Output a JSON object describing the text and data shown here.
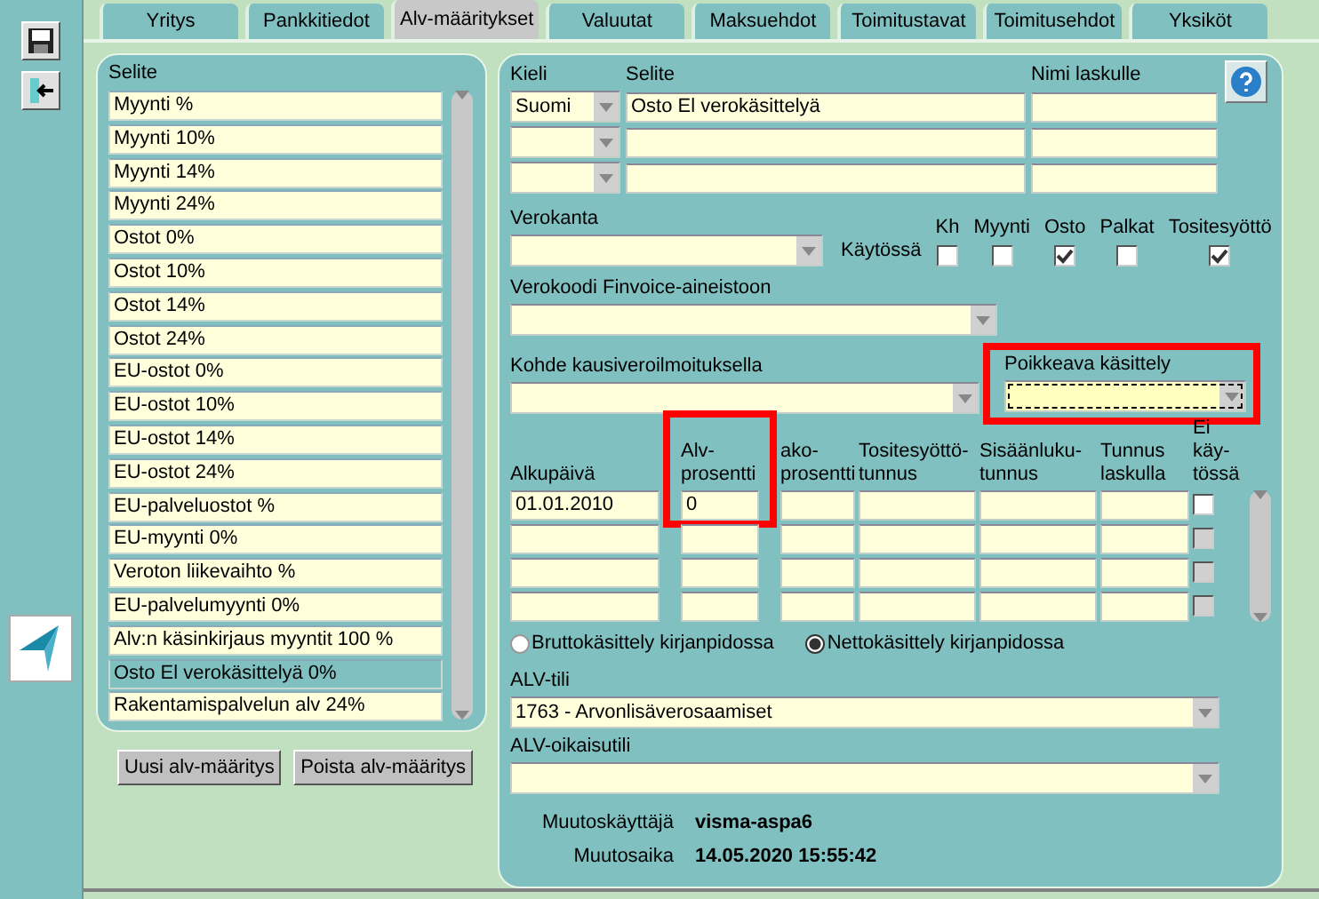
{
  "tabs": [
    {
      "label": "Yritys",
      "selected": false
    },
    {
      "label": "Pankkitiedot",
      "selected": false
    },
    {
      "label": "Alv-määritykset",
      "selected": true
    },
    {
      "label": "Valuutat",
      "selected": false
    },
    {
      "label": "Maksuehdot",
      "selected": false
    },
    {
      "label": "Toimitustavat",
      "selected": false
    },
    {
      "label": "Toimitusehdot",
      "selected": false
    },
    {
      "label": "Yksiköt",
      "selected": false
    }
  ],
  "definitions": {
    "header": "Selite",
    "items": [
      {
        "label": "Myynti %",
        "selected": false
      },
      {
        "label": "Myynti 10%",
        "selected": false
      },
      {
        "label": "Myynti 14%",
        "selected": false
      },
      {
        "label": "Myynti 24%",
        "selected": false
      },
      {
        "label": "Ostot 0%",
        "selected": false
      },
      {
        "label": "Ostot 10%",
        "selected": false
      },
      {
        "label": "Ostot 14%",
        "selected": false
      },
      {
        "label": "Ostot 24%",
        "selected": false
      },
      {
        "label": "EU-ostot 0%",
        "selected": false
      },
      {
        "label": "EU-ostot 10%",
        "selected": false
      },
      {
        "label": "EU-ostot 14%",
        "selected": false
      },
      {
        "label": "EU-ostot 24%",
        "selected": false
      },
      {
        "label": "EU-palveluostot %",
        "selected": false
      },
      {
        "label": "EU-myynti 0%",
        "selected": false
      },
      {
        "label": "Veroton liikevaihto %",
        "selected": false
      },
      {
        "label": "EU-palvelumyynti 0%",
        "selected": false
      },
      {
        "label": "Alv:n käsinkirjaus myyntit 100 %",
        "selected": false
      },
      {
        "label": "Osto El verokäsittelyä 0%",
        "selected": true
      },
      {
        "label": "Rakentamispalvelun alv 24%",
        "selected": false
      }
    ]
  },
  "buttons": [
    "Uusi alv-määritys",
    "Poista alv-määritys"
  ],
  "names": {
    "language_label": "Kieli",
    "description_label": "Selite",
    "invoice_label": "Nimi laskulle",
    "rows": [
      {
        "language": "Suomi",
        "description": "Osto El verokäsittelyä"
      },
      {},
      {}
    ]
  },
  "tax_rate": {
    "label": "Verokanta"
  },
  "in_use": {
    "label": "Käytössä",
    "flags": [
      {
        "label": "Kh",
        "checked": false
      },
      {
        "label": "Myynti",
        "checked": false
      },
      {
        "label": "Osto",
        "checked": true
      },
      {
        "label": "Palkat",
        "checked": false
      },
      {
        "label": "Tositesyöttö",
        "checked": true
      }
    ]
  },
  "finvoice_code": {
    "label": "Verokoodi Finvoice-aineistoon"
  },
  "periodic_report": {
    "label": "Kohde kausiveroilmoituksella"
  },
  "exception": {
    "label": "Poikkeava käsittely",
    "highlighted": true
  },
  "rates": {
    "columns": [
      {
        "label": "Alkupäivä",
        "kind": "text",
        "highlighted": false
      },
      {
        "label": "Alv-\nprosentti",
        "kind": "text",
        "highlighted": true
      },
      {
        "label": "ako-\nprosentti",
        "kind": "text",
        "highlighted": false
      },
      {
        "label": "Tositesyöttö-\ntunnus",
        "kind": "text",
        "highlighted": false
      },
      {
        "label": "Sisäänluku-\ntunnus",
        "kind": "text",
        "highlighted": false
      },
      {
        "label": "Tunnus\nlaskulla",
        "kind": "text",
        "highlighted": false
      },
      {
        "label": "Ei käy-\ntössä",
        "kind": "check",
        "highlighted": false
      }
    ],
    "rows": [
      {
        "start": "01.01.2010",
        "rate": "0",
        "disabled": false
      },
      {
        "disabled": true
      },
      {
        "disabled": true
      },
      {
        "disabled": true
      }
    ]
  },
  "bookkeeping": [
    {
      "label": "Bruttokäsittely kirjanpidossa",
      "selected": false
    },
    {
      "label": "Nettokäsittely kirjanpidossa",
      "selected": true
    }
  ],
  "vat_account": {
    "label": "ALV-tili",
    "value": "1763 - Arvonlisäverosaamiset"
  },
  "vat_adjustment_account": {
    "label": "ALV-oikaisutili"
  },
  "audit": [
    {
      "label": "Muutoskäyttäjä",
      "value": "visma-aspa6"
    },
    {
      "label": "Muutosaika",
      "value": "14.05.2020 15:55:42"
    }
  ]
}
